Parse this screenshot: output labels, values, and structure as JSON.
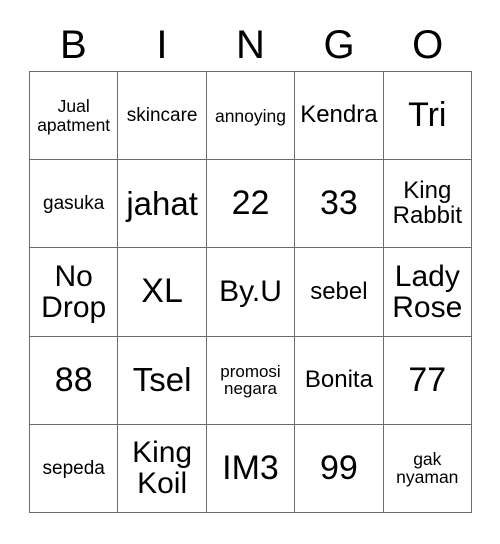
{
  "card": {
    "title": "BINGO",
    "header_letters": [
      "B",
      "I",
      "N",
      "G",
      "O"
    ],
    "grid_size": "5x5",
    "colors": {
      "background": "#ffffff",
      "text": "#000000",
      "grid_line": "#6b6b6b"
    },
    "rows": [
      [
        {
          "text": "Jual\napatment",
          "size": "fs-xxs"
        },
        {
          "text": "skincare",
          "size": "fs-xs"
        },
        {
          "text": "annoying",
          "size": "fs-xxs"
        },
        {
          "text": "Kendra",
          "size": "fs-sm"
        },
        {
          "text": "Tri",
          "size": "fs-xl"
        }
      ],
      [
        {
          "text": "gasuka",
          "size": "fs-xs"
        },
        {
          "text": "jahat",
          "size": "fs-lg"
        },
        {
          "text": "22",
          "size": "fs-xl"
        },
        {
          "text": "33",
          "size": "fs-xl"
        },
        {
          "text": "King\nRabbit",
          "size": "fs-sm"
        }
      ],
      [
        {
          "text": "No\nDrop",
          "size": "fs-md"
        },
        {
          "text": "XL",
          "size": "fs-xl"
        },
        {
          "text": "By.U",
          "size": "fs-md"
        },
        {
          "text": "sebel",
          "size": "fs-sm"
        },
        {
          "text": "Lady\nRose",
          "size": "fs-md"
        }
      ],
      [
        {
          "text": "88",
          "size": "fs-xl"
        },
        {
          "text": "Tsel",
          "size": "fs-lg"
        },
        {
          "text": "promosi\nnegara",
          "size": "fs-tiny"
        },
        {
          "text": "Bonita",
          "size": "fs-sm"
        },
        {
          "text": "77",
          "size": "fs-xl"
        }
      ],
      [
        {
          "text": "sepeda",
          "size": "fs-xs"
        },
        {
          "text": "King\nKoil",
          "size": "fs-md"
        },
        {
          "text": "IM3",
          "size": "fs-xl"
        },
        {
          "text": "99",
          "size": "fs-xl"
        },
        {
          "text": "gak\nnyaman",
          "size": "fs-xxs"
        }
      ]
    ]
  }
}
